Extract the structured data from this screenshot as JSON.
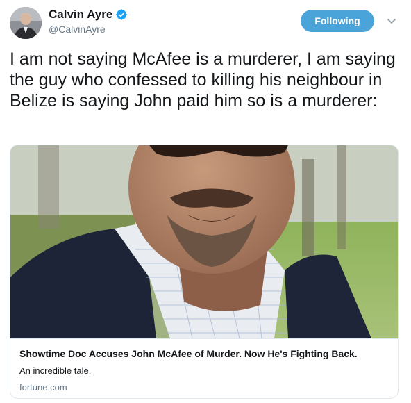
{
  "author": {
    "display_name": "Calvin Ayre",
    "handle": "@CalvinAyre",
    "verified": true,
    "avatar_icon": "user-avatar-photo",
    "verified_icon": "verified-badge-icon"
  },
  "actions": {
    "follow_label": "Following",
    "menu_icon": "chevron-down-icon"
  },
  "tweet": {
    "text": "I am not saying McAfee is a murderer, I am saying the guy who confessed to killing his neighbour in Belize is saying John paid him so is a murderer:"
  },
  "card": {
    "title": "Showtime Doc Accuses John McAfee of Murder. Now He's Fighting Back.",
    "description": "An incredible tale.",
    "domain": "fortune.com",
    "image_icon": "article-photo"
  },
  "colors": {
    "follow_button": "#4aa3d9",
    "verified": "#1da1f2",
    "secondary_text": "#657786",
    "border": "#e1e8ed"
  }
}
